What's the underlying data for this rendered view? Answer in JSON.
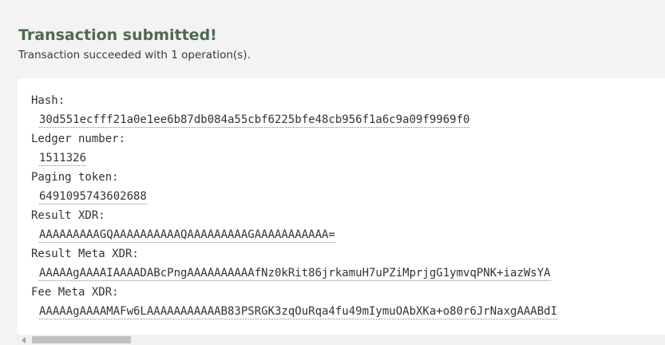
{
  "header": {
    "title": "Transaction submitted!",
    "subtitle": "Transaction succeeded with 1 operation(s)."
  },
  "fields": [
    {
      "label": "Hash:",
      "value": "30d551ecfff21a0e1ee6b87db084a55cbf6225bfe48cb956f1a6c9a09f9969f0"
    },
    {
      "label": "Ledger number:",
      "value": "1511326"
    },
    {
      "label": "Paging token:",
      "value": "6491095743602688"
    },
    {
      "label": "Result XDR:",
      "value": "AAAAAAAAAGQAAAAAAAAAAQAAAAAAAAAGAAAAAAAAAAA="
    },
    {
      "label": "Result Meta XDR:",
      "value": "AAAAAgAAAAIAAAADABcPngAAAAAAAAAAfNz0kRit86jrkamuH7uPZiMprjgG1ymvqPNK+iazWsYA"
    },
    {
      "label": "Fee Meta XDR:",
      "value": "AAAAAgAAAAMAFw6LAAAAAAAAAAAB83PSRGK3zqOuRqa4fu49mIymuOAbXKa+o80r6JrNaxgAAABdI"
    }
  ]
}
